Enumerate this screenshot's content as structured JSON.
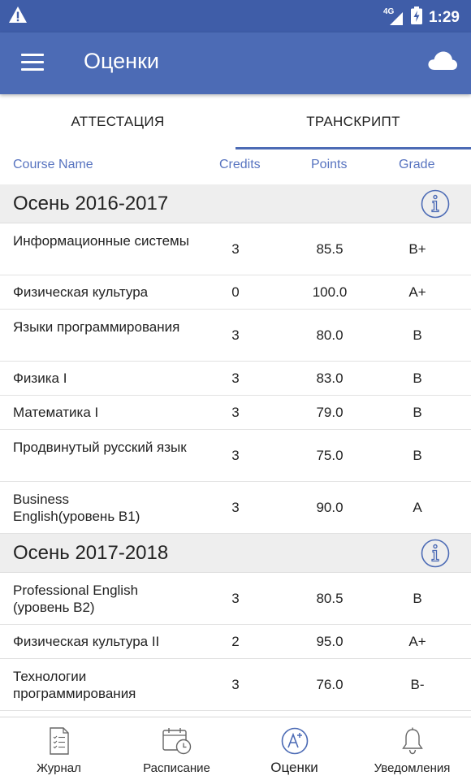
{
  "status": {
    "network": "4G",
    "time": "1:29"
  },
  "appbar": {
    "title": "Оценки"
  },
  "tabs": [
    {
      "label": "АТТЕСТАЦИЯ"
    },
    {
      "label": "ТРАНСКРИПТ"
    }
  ],
  "columns": {
    "course": "Course Name",
    "credits": "Credits",
    "points": "Points",
    "grade": "Grade"
  },
  "semesters": [
    {
      "label": "Осень 2016-2017",
      "courses": [
        {
          "name": "Информационные системы",
          "credits": "3",
          "points": "85.5",
          "grade": "B+"
        },
        {
          "name": "Физическая культура",
          "credits": "0",
          "points": "100.0",
          "grade": "A+"
        },
        {
          "name": "Языки программирования",
          "credits": "3",
          "points": "80.0",
          "grade": "B"
        },
        {
          "name": "Физика I",
          "credits": "3",
          "points": "83.0",
          "grade": "B"
        },
        {
          "name": "Математика I",
          "credits": "3",
          "points": "79.0",
          "grade": "B"
        },
        {
          "name": "Продвинутый русский язык",
          "credits": "3",
          "points": "75.0",
          "grade": "B"
        },
        {
          "name": "Business English(уровень B1)",
          "credits": "3",
          "points": "90.0",
          "grade": "A"
        }
      ]
    },
    {
      "label": "Осень 2017-2018",
      "courses": [
        {
          "name": "Professional English (уровень B2)",
          "credits": "3",
          "points": "80.5",
          "grade": "B"
        },
        {
          "name": "Физическая культура II",
          "credits": "2",
          "points": "95.0",
          "grade": "A+"
        },
        {
          "name": "Технологии программирования",
          "credits": "3",
          "points": "76.0",
          "grade": "B-"
        }
      ]
    }
  ],
  "bottomnav": [
    {
      "label": "Журнал",
      "icon": "journal-icon"
    },
    {
      "label": "Расписание",
      "icon": "calendar-clock-icon"
    },
    {
      "label": "Оценки",
      "icon": "grade-icon"
    },
    {
      "label": "Уведомления",
      "icon": "bell-icon"
    }
  ],
  "colors": {
    "appbar": "#4c6bb5",
    "statusbar": "#3f5da8",
    "accent": "#5874c0"
  }
}
